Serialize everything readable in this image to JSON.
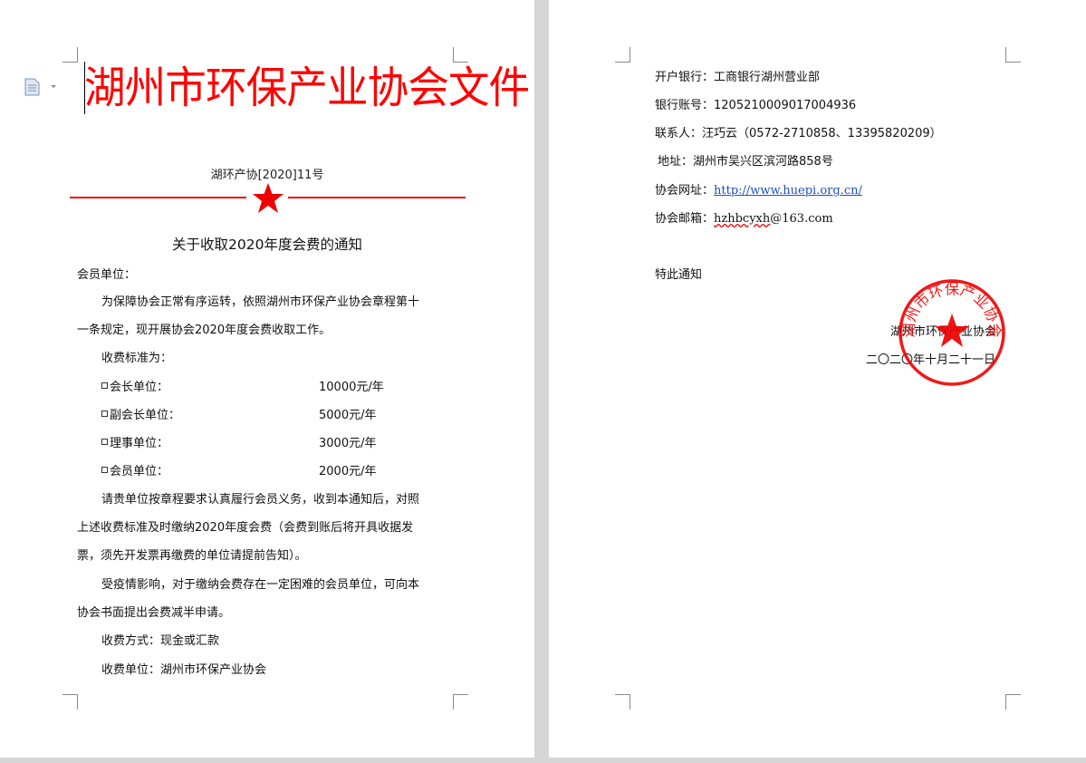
{
  "page1": {
    "header_title": "湖州市环保产业协会文件",
    "doc_number": "湖环产协[2020]11号",
    "notice_title": "关于收取2020年度会费的通知",
    "salutation": "会员单位：",
    "para1_line1": "为保障协会正常有序运转，依照湖州市环保产业协会章程第十",
    "para1_line2": "一条规定，现开展协会2020年度会费收取工作。",
    "fee_intro": "收费标准为：",
    "fees": [
      {
        "unit": "会长单位：",
        "amount": "10000元/年"
      },
      {
        "unit": "副会长单位：",
        "amount": "5000元/年"
      },
      {
        "unit": "理事单位：",
        "amount": "3000元/年"
      },
      {
        "unit": "会员单位：",
        "amount": "2000元/年"
      }
    ],
    "para2_line1": "请贵单位按章程要求认真履行会员义务，收到本通知后，对照",
    "para2_line2": "上述收费标准及时缴纳2020年度会费（会费到账后将开具收据发",
    "para2_line3": "票，须先开发票再缴费的单位请提前告知）。",
    "para3_line1": "受疫情影响，对于缴纳会费存在一定困难的会员单位，可向本",
    "para3_line2": "协会书面提出会费减半申请。",
    "payment_method": "收费方式：现金或汇款",
    "payee": "收费单位：湖州市环保产业协会"
  },
  "page2": {
    "bank": "开户银行：工商银行湖州营业部",
    "account": "银行账号：1205210009017004936",
    "contact": "联系人：汪巧云（0572-2710858、13395820209）",
    "address": "地址：湖州市吴兴区滨河路858号",
    "website_label": "协会网址：",
    "website_url": "http://www.huepi.org.cn/",
    "email_label": "协会邮箱：",
    "email_name": "hzhbcyxh",
    "email_domain": "@163.com",
    "closing": "特此通知",
    "signer": "湖州市环保产业协会",
    "date": "二〇二〇年十月二十一日"
  },
  "seal": {
    "text": "湖州市环保产业协会"
  },
  "colors": {
    "red": "#ff0000",
    "link": "#1f4fbf"
  }
}
